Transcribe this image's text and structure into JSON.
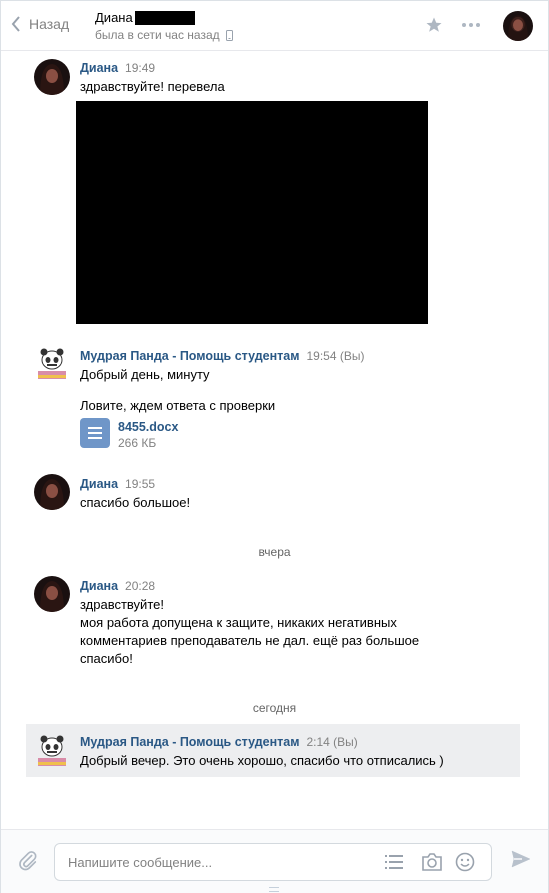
{
  "header": {
    "back_label": "Назад",
    "peer_name": "Диана",
    "peer_status": "была в сети час назад"
  },
  "messages": [
    {
      "author": "Диана",
      "time": "19:49",
      "lines": [
        "здравствуйте! перевела"
      ]
    },
    {
      "author": "Мудрая Панда - Помощь студентам",
      "time": "19:54 (Вы)",
      "lines": [
        "Добрый день, минуту",
        "Ловите, ждем ответа с проверки"
      ],
      "attachment": {
        "name": "8455.docx",
        "size": "266 КБ"
      }
    },
    {
      "author": "Диана",
      "time": "19:55",
      "lines": [
        "спасибо большое!"
      ]
    },
    {
      "author": "Диана",
      "time": "20:28",
      "lines": [
        "здравствуйте!",
        "моя работа допущена к защите, никаких негативных",
        "комментариев преподаватель не дал. ещё раз большое",
        "спасибо!"
      ]
    },
    {
      "author": "Мудрая Панда - Помощь студентам",
      "time": "2:14 (Вы)",
      "lines": [
        "Добрый вечер. Это очень хорошо, спасибо что отписались )"
      ]
    }
  ],
  "dividers": {
    "yesterday": "вчера",
    "today": "сегодня"
  },
  "composer": {
    "placeholder": "Напишите сообщение..."
  },
  "colors": {
    "link": "#2a5885",
    "muted": "#828282",
    "highlight": "#edeef0",
    "doc": "#6f96c8"
  }
}
